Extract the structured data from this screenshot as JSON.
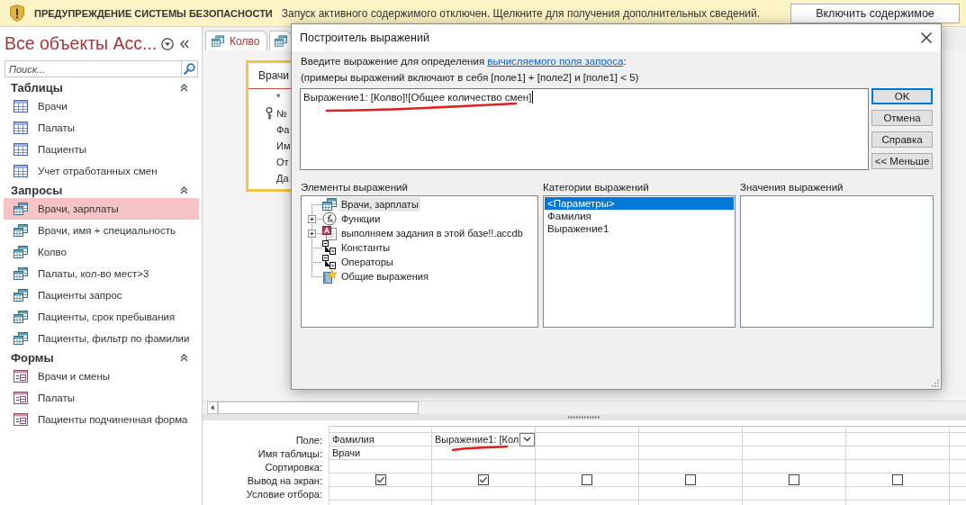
{
  "security_bar": {
    "title": "ПРЕДУПРЕЖДЕНИЕ СИСТЕМЫ БЕЗОПАСНОСТИ",
    "message": "Запуск активного содержимого отключен. Щелкните для получения дополнительных сведений.",
    "button": "Включить содержимое"
  },
  "navigation": {
    "title": "Все объекты Асс...",
    "search": {
      "placeholder": "Поиск..."
    },
    "groups": [
      {
        "label": "Таблицы",
        "expanded": true,
        "items": [
          {
            "label": "Врачи",
            "kind": "table",
            "selected": false
          },
          {
            "label": "Палаты",
            "kind": "table",
            "selected": false
          },
          {
            "label": "Пациенты",
            "kind": "table",
            "selected": false
          },
          {
            "label": "Учет отработанных смен",
            "kind": "table",
            "selected": false
          }
        ]
      },
      {
        "label": "Запросы",
        "expanded": true,
        "items": [
          {
            "label": "Врачи, зарплаты",
            "kind": "query",
            "selected": true
          },
          {
            "label": "Врачи, имя + специальность",
            "kind": "query",
            "selected": false
          },
          {
            "label": "Колво",
            "kind": "query",
            "selected": false
          },
          {
            "label": "Палаты, кол-во мест>3",
            "kind": "query",
            "selected": false
          },
          {
            "label": "Пациенты запрос",
            "kind": "query",
            "selected": false
          },
          {
            "label": "Пациенты, срок пребывания",
            "kind": "query",
            "selected": false
          },
          {
            "label": "Пациенты, фильтр по фамилии",
            "kind": "query",
            "selected": false
          }
        ]
      },
      {
        "label": "Формы",
        "expanded": true,
        "items": [
          {
            "label": "Врачи и смены",
            "kind": "form",
            "selected": false
          },
          {
            "label": "Палаты",
            "kind": "form",
            "selected": false
          },
          {
            "label": "Пациенты подчиненная форма",
            "kind": "form",
            "selected": false
          }
        ]
      }
    ]
  },
  "tabs": [
    {
      "kind": "query",
      "label": "Колво"
    },
    {
      "kind": "query"
    }
  ],
  "query_design": {
    "table": {
      "title": "Врачи",
      "fields": [
        {
          "name": "*",
          "key": false
        },
        {
          "name": "№",
          "key": true
        },
        {
          "name": "Фа",
          "key": false
        },
        {
          "name": "Им",
          "key": false
        },
        {
          "name": "От",
          "key": false
        },
        {
          "name": "Да",
          "key": false
        }
      ]
    }
  },
  "grid": {
    "row_labels": [
      "Поле:",
      "Имя таблицы:",
      "Сортировка:",
      "Вывод на экран:",
      "Условие отбора:"
    ],
    "columns": [
      {
        "field": "Фамилия",
        "table": "Врачи",
        "show": true,
        "focused": false
      },
      {
        "field": "Выражение1: [Кол",
        "show": true,
        "focused": true
      },
      {
        "show": false,
        "focused": false
      },
      {
        "show": false,
        "focused": false
      },
      {
        "show": false,
        "focused": false
      },
      {
        "show": false,
        "focused": false
      }
    ]
  },
  "dialog": {
    "title": "Построитель выражений",
    "instruction": {
      "text": "Введите выражение для определения",
      "link": "вычисляемого поля запроса",
      "suffix": ":"
    },
    "examples": "(примеры выражений включают в себя [поле1] + [поле2] и [поле1] < 5)",
    "expression": "Выражение1: [Колво]![Общее количество смен]",
    "buttons": [
      {
        "label": "OK",
        "default": true
      },
      {
        "label": "Отмена",
        "default": false
      },
      {
        "label": "Справка",
        "default": false
      },
      {
        "label": "<< Меньше",
        "default": false
      }
    ],
    "elements": {
      "label": "Элементы выражений",
      "items": [
        {
          "label": "Врачи, зарплаты",
          "kind": "query",
          "selected": true,
          "expandable": false
        },
        {
          "label": "Функции",
          "kind": "functions",
          "selected": false,
          "expandable": true,
          "expanded": false
        },
        {
          "label": "выполняем задания в этой базе!!.accdb",
          "kind": "database",
          "selected": false,
          "expandable": true,
          "expanded": false
        },
        {
          "label": "Константы",
          "kind": "constants",
          "selected": false,
          "expandable": false
        },
        {
          "label": "Операторы",
          "kind": "operators",
          "selected": false,
          "expandable": false
        },
        {
          "label": "Общие выражения",
          "kind": "common",
          "selected": false,
          "expandable": false
        }
      ]
    },
    "categories": {
      "label": "Категории выражений",
      "items": [
        {
          "label": "<Параметры>",
          "selected": true
        },
        {
          "label": "Фамилия",
          "selected": false
        },
        {
          "label": "Выражение1",
          "selected": false
        }
      ]
    },
    "values": {
      "label": "Значения выражений"
    }
  }
}
